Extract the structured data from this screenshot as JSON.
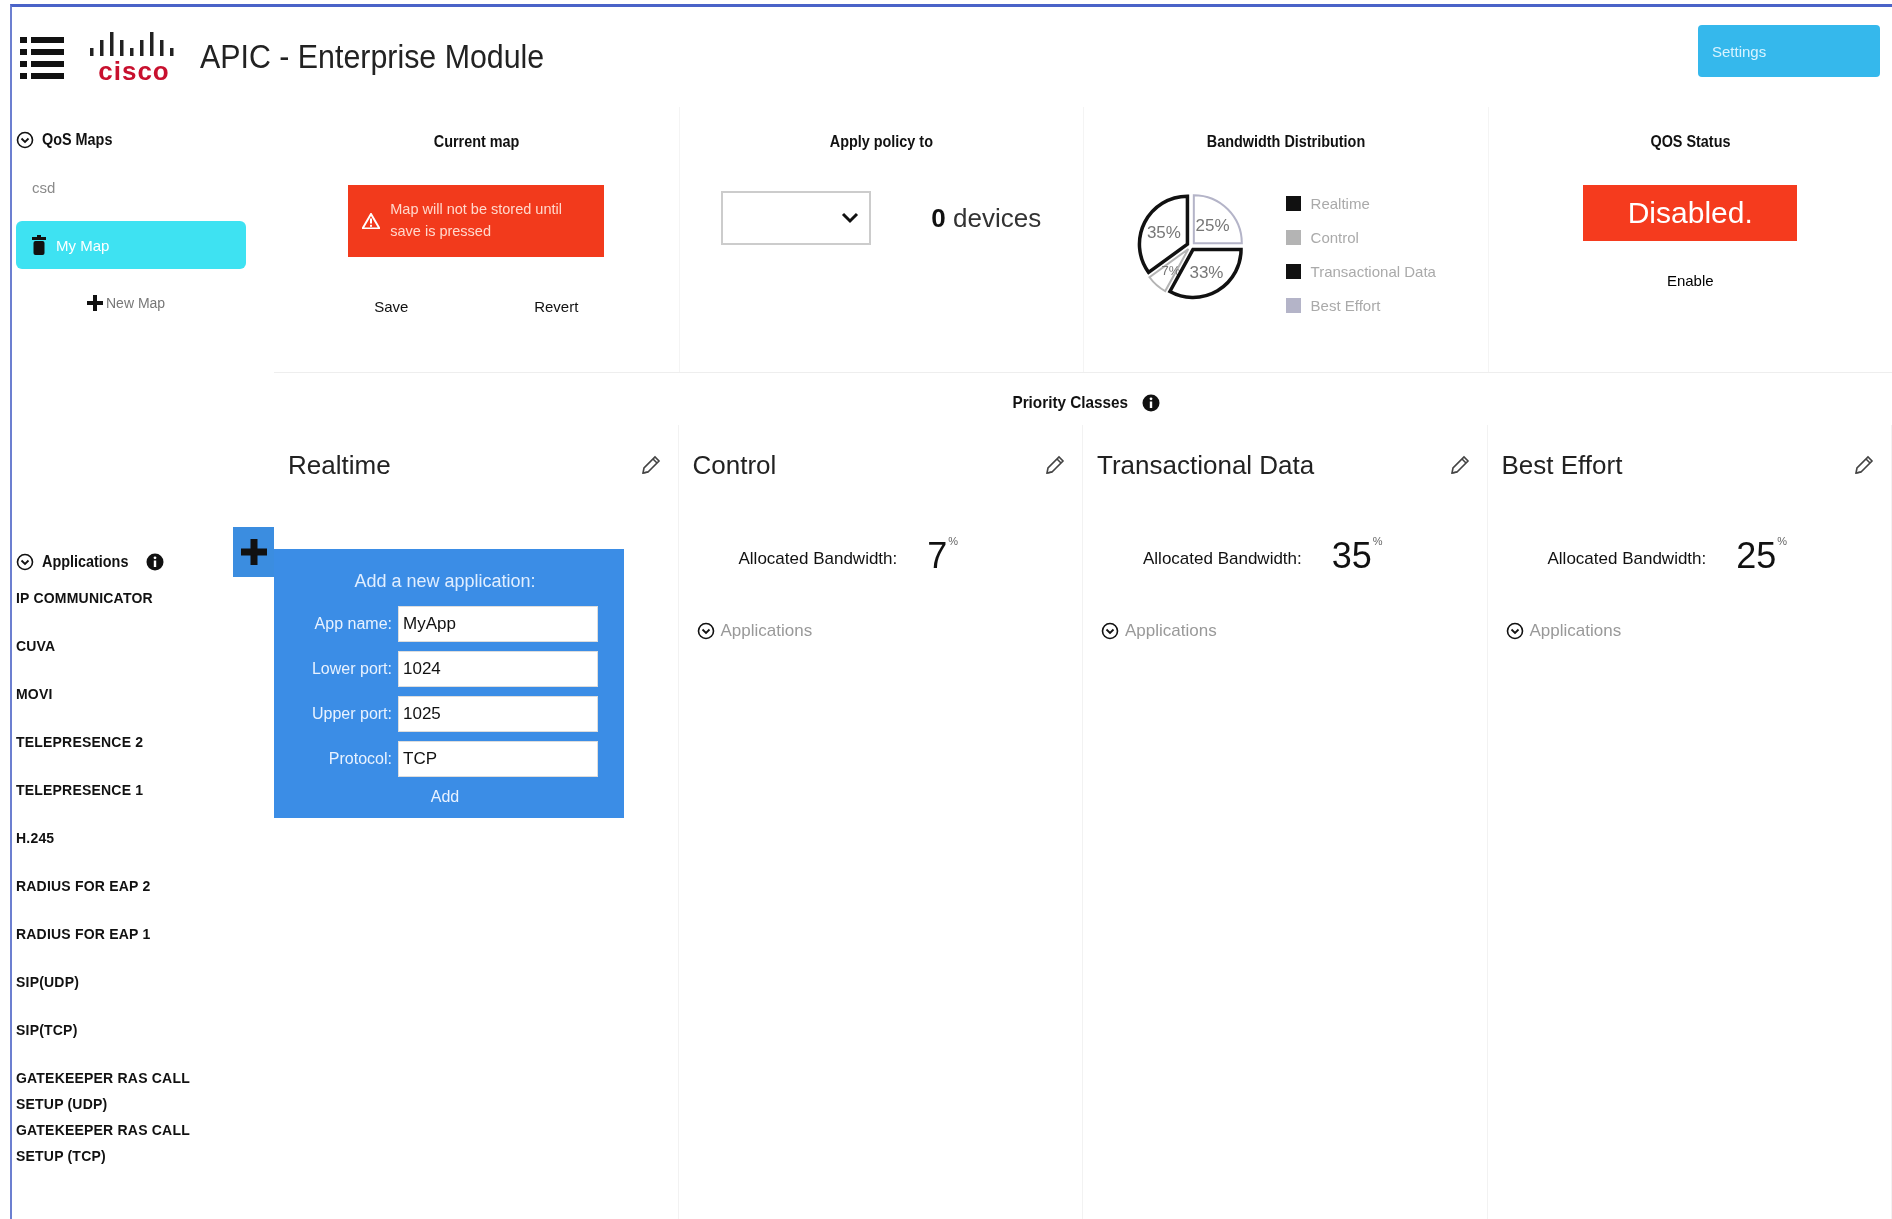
{
  "header": {
    "title": "APIC - Enterprise Module",
    "logo_text": "cisco",
    "settings_button": "Settings"
  },
  "sidebar": {
    "qos_maps": {
      "title": "QoS Maps",
      "expanded": true,
      "maps": [
        {
          "name": "csd",
          "selected": false
        },
        {
          "name": "My Map",
          "selected": true
        }
      ],
      "new_map": "New Map"
    },
    "applications": {
      "title": "Applications",
      "expanded": true,
      "items": [
        "IP COMMUNICATOR",
        "CUVA",
        "MOVI",
        "TELEPRESENCE 2",
        "TELEPRESENCE 1",
        "H.245",
        "RADIUS FOR EAP 2",
        "RADIUS FOR EAP 1",
        "SIP(UDP)",
        "SIP(TCP)",
        "GATEKEEPER RAS CALL SETUP (UDP)",
        "GATEKEEPER RAS CALL SETUP (TCP)"
      ]
    }
  },
  "current_map": {
    "title": "Current map",
    "warning": "Map will not be stored until save is pressed",
    "save": "Save",
    "revert": "Revert"
  },
  "apply_policy": {
    "title": "Apply policy to",
    "device_count": "0",
    "device_unit": "devices"
  },
  "bandwidth": {
    "legend": [
      {
        "color": "#111111"
      },
      {
        "color": "#b4b4b4"
      },
      {
        "color": "#111111"
      },
      {
        "color": "#b4b4c8"
      }
    ],
    "chart_data": {
      "type": "pie",
      "title": "Bandwidth Distribution",
      "categories": [
        "Realtime",
        "Control",
        "Transactional Data",
        "Best Effort"
      ],
      "values": [
        35,
        7,
        33,
        25
      ],
      "value_labels": [
        "35%",
        "7%",
        "33%",
        "25%"
      ]
    }
  },
  "qos_status": {
    "title": "QOS Status",
    "enabled": false,
    "status_label": "Disabled.",
    "toggle": "Enable"
  },
  "priority_classes": {
    "title": "Priority Classes",
    "classes": [
      {
        "kind": "form",
        "name": "Realtime",
        "form": {
          "title": "Add a new application:",
          "fields": [
            {
              "label": "App name:",
              "value": "MyApp"
            },
            {
              "label": "Lower port:",
              "value": "1024"
            },
            {
              "label": "Upper port:",
              "value": "1025"
            },
            {
              "label": "Protocol:",
              "value": "TCP"
            }
          ],
          "submit": "Add"
        }
      },
      {
        "kind": "summary",
        "name": "Control",
        "bandwidth_label": "Allocated Bandwidth:",
        "bandwidth": "7",
        "unit": "%",
        "applications": "Applications"
      },
      {
        "kind": "summary",
        "name": "Transactional Data",
        "bandwidth_label": "Allocated Bandwidth:",
        "bandwidth": "35",
        "unit": "%",
        "applications": "Applications"
      },
      {
        "kind": "summary",
        "name": "Best Effort",
        "bandwidth_label": "Allocated Bandwidth:",
        "bandwidth": "25",
        "unit": "%",
        "applications": "Applications"
      }
    ]
  }
}
